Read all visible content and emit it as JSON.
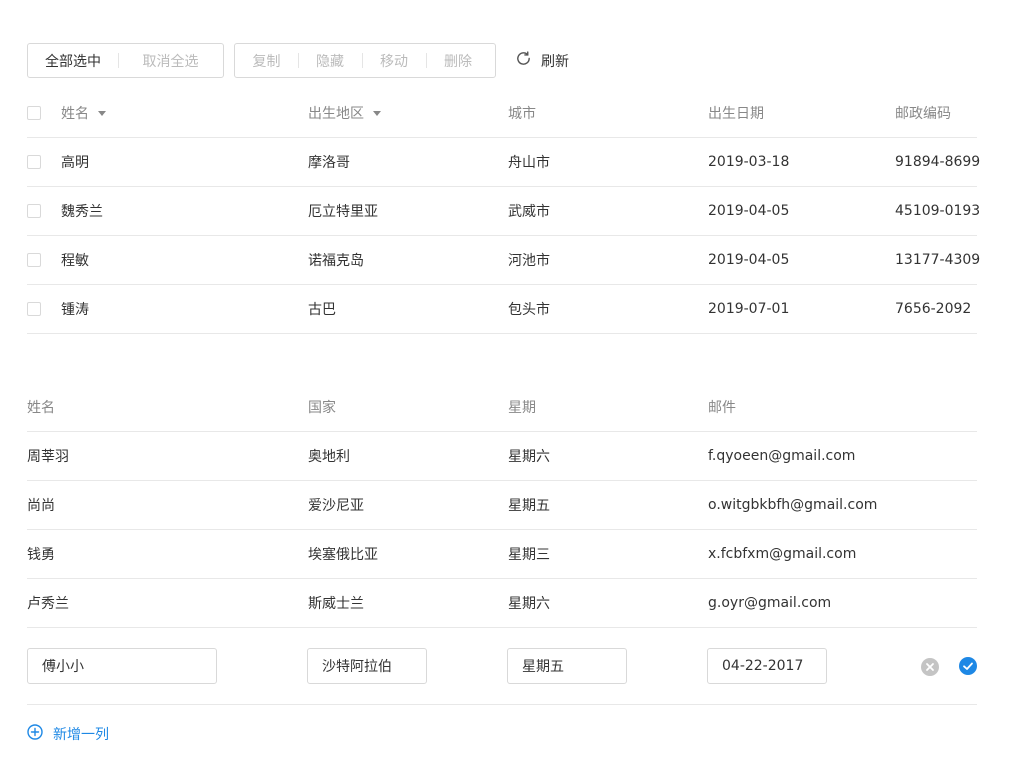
{
  "toolbar": {
    "select_all": "全部选中",
    "deselect_all": "取消全选",
    "copy": "复制",
    "hide": "隐藏",
    "move": "移动",
    "delete": "删除",
    "refresh": "刷新"
  },
  "table1": {
    "headers": {
      "name": "姓名",
      "region": "出生地区",
      "city": "城市",
      "date": "出生日期",
      "zip": "邮政编码"
    },
    "rows": [
      {
        "name": "高明",
        "region": "摩洛哥",
        "city": "舟山市",
        "date": "2019-03-18",
        "zip": "91894-8699"
      },
      {
        "name": "魏秀兰",
        "region": "厄立特里亚",
        "city": "武威市",
        "date": "2019-04-05",
        "zip": "45109-0193"
      },
      {
        "name": "程敏",
        "region": "诺福克岛",
        "city": "河池市",
        "date": "2019-04-05",
        "zip": "13177-4309"
      },
      {
        "name": "锺涛",
        "region": "古巴",
        "city": "包头市",
        "date": "2019-07-01",
        "zip": "7656-2092"
      }
    ]
  },
  "table2": {
    "headers": {
      "name": "姓名",
      "country": "国家",
      "week": "星期",
      "mail": "邮件"
    },
    "rows": [
      {
        "name": "周莘羽",
        "country": "奥地利",
        "week": "星期六",
        "mail": "f.qyoeen@gmail.com"
      },
      {
        "name": "尚尚",
        "country": "爱沙尼亚",
        "week": "星期五",
        "mail": "o.witgbkbfh@gmail.com"
      },
      {
        "name": "钱勇",
        "country": "埃塞俄比亚",
        "week": "星期三",
        "mail": "x.fcbfxm@gmail.com"
      },
      {
        "name": "卢秀兰",
        "country": "斯威士兰",
        "week": "星期六",
        "mail": "g.oyr@gmail.com"
      }
    ],
    "edit": {
      "name": "傅小小",
      "country": "沙特阿拉伯",
      "week": "星期五",
      "date": "04-22-2017"
    }
  },
  "add_column": "新增一列",
  "colors": {
    "accent": "#1e88e5",
    "muted": "#bbbbbb",
    "border": "#d9d9d9"
  },
  "icons": {
    "refresh": "refresh-icon",
    "cancel": "clear-circle-icon",
    "confirm": "check-circle-icon",
    "add": "plus-circle-icon"
  }
}
